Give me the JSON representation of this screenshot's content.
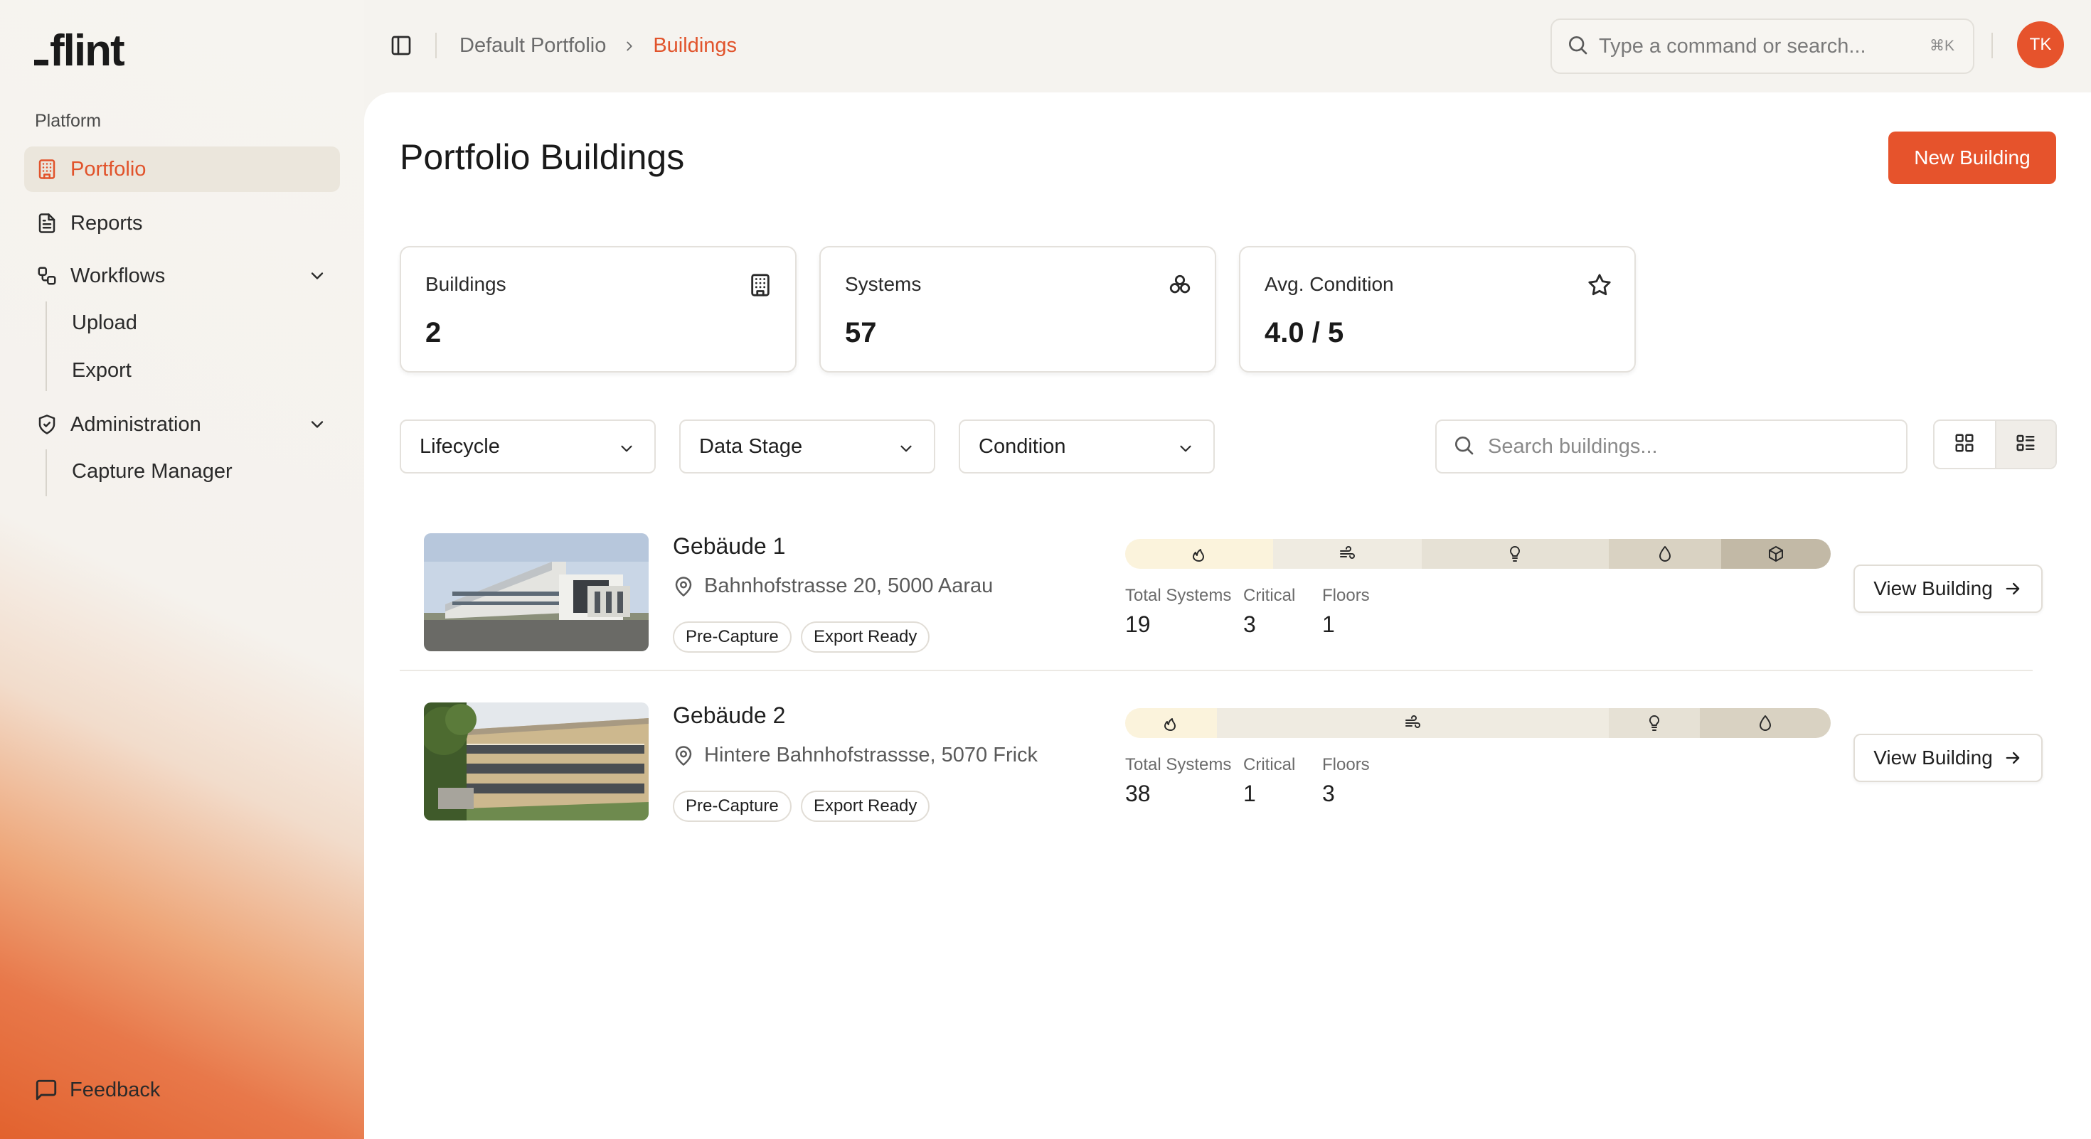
{
  "brand": {
    "logo_text": "flint"
  },
  "sidebar": {
    "section_label": "Platform",
    "items": [
      {
        "label": "Portfolio",
        "icon": "building-icon",
        "active": true
      },
      {
        "label": "Reports",
        "icon": "document-icon"
      },
      {
        "label": "Workflows",
        "icon": "workflow-icon",
        "expanded": true,
        "children": [
          "Upload",
          "Export"
        ]
      },
      {
        "label": "Administration",
        "icon": "shield-check-icon",
        "expanded": true,
        "children": [
          "Capture Manager"
        ]
      }
    ],
    "feedback_label": "Feedback"
  },
  "topbar": {
    "breadcrumb": [
      "Default Portfolio",
      "Buildings"
    ],
    "command_placeholder": "Type a command or search...",
    "command_shortcut": "⌘K",
    "avatar_initials": "TK"
  },
  "page": {
    "title": "Portfolio Buildings",
    "new_button": "New Building",
    "stats": [
      {
        "label": "Buildings",
        "value": "2",
        "icon": "building-icon"
      },
      {
        "label": "Systems",
        "value": "57",
        "icon": "systems-icon"
      },
      {
        "label": "Avg. Condition",
        "value": "4.0 / 5",
        "icon": "star-icon"
      }
    ],
    "filters": [
      "Lifecycle",
      "Data Stage",
      "Condition"
    ],
    "search_placeholder": "Search buildings...",
    "metric_labels": {
      "total": "Total Systems",
      "critical": "Critical",
      "floors": "Floors"
    },
    "view_button": "View Building",
    "buildings": [
      {
        "name": "Gebäude 1",
        "address": "Bahnhofstrasse 20, 5000 Aarau",
        "tags": [
          "Pre-Capture",
          "Export Ready"
        ],
        "total_systems": "19",
        "critical": "3",
        "floors": "1",
        "system_mix": [
          {
            "icon": "flame-icon",
            "share": 0.21,
            "color": "#fbf3dc"
          },
          {
            "icon": "wind-icon",
            "share": 0.21,
            "color": "#efebe1"
          },
          {
            "icon": "lightbulb-icon",
            "share": 0.265,
            "color": "#e6e1d5"
          },
          {
            "icon": "droplet-icon",
            "share": 0.16,
            "color": "#d9d2c2"
          },
          {
            "icon": "cube-icon",
            "share": 0.155,
            "color": "#c2b9a6"
          }
        ]
      },
      {
        "name": "Gebäude 2",
        "address": "Hintere Bahnhofstrassse, 5070 Frick",
        "tags": [
          "Pre-Capture",
          "Export Ready"
        ],
        "total_systems": "38",
        "critical": "1",
        "floors": "3",
        "system_mix": [
          {
            "icon": "flame-icon",
            "share": 0.13,
            "color": "#fbf3dc"
          },
          {
            "icon": "wind-icon",
            "share": 0.555,
            "color": "#efebe1"
          },
          {
            "icon": "lightbulb-icon",
            "share": 0.13,
            "color": "#e6e1d5"
          },
          {
            "icon": "droplet-icon",
            "share": 0.185,
            "color": "#d9d2c2"
          }
        ]
      }
    ]
  }
}
